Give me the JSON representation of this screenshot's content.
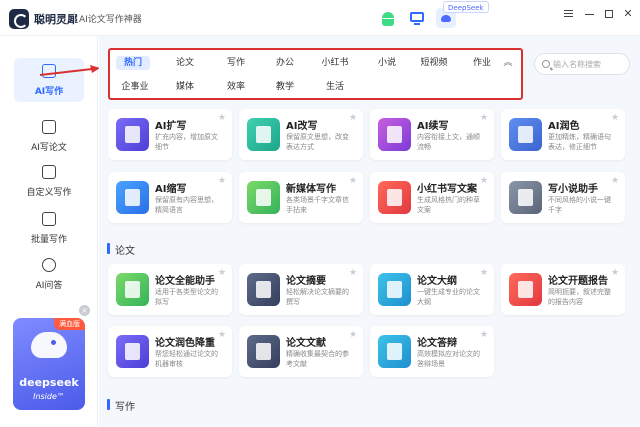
{
  "app": {
    "name": "聪明灵犀",
    "subtitle": "AI论文写作神器",
    "deepseek_badge": "DeepSeek"
  },
  "window_controls": {
    "icons": [
      "menu-icon",
      "minimize-icon",
      "maximize-icon",
      "close-icon"
    ],
    "close_glyph": "✕"
  },
  "sidebar": {
    "items": [
      {
        "label": "AI写作",
        "icon": "pen-icon",
        "active": true
      },
      {
        "label": "AI写论文",
        "icon": "paper-icon"
      },
      {
        "label": "自定义写作",
        "icon": "chart-icon"
      },
      {
        "label": "批量写作",
        "icon": "docs-icon"
      },
      {
        "label": "AI问答",
        "icon": "chat-bot-icon"
      }
    ],
    "promo": {
      "flag": "满血版",
      "brand": "deepseek",
      "sub": "Inside™",
      "close": "×"
    }
  },
  "categories": {
    "row1": [
      "热门",
      "论文",
      "写作",
      "办公",
      "小红书",
      "小说",
      "短视频",
      "作业"
    ],
    "row2": [
      "企事业",
      "媒体",
      "效率",
      "教学",
      "生活"
    ],
    "active": "热门",
    "collapse_glyph": "︽"
  },
  "search": {
    "placeholder": "输入名称搜索"
  },
  "hot_cards": [
    {
      "title": "AI扩写",
      "desc": "扩充内容，增加原文细节",
      "color": "purple"
    },
    {
      "title": "AI改写",
      "desc": "保留原文思想，改变表达方式",
      "color": "teal"
    },
    {
      "title": "AI续写",
      "desc": "内容衔接上文，通顺流畅",
      "color": "pink"
    },
    {
      "title": "AI润色",
      "desc": "更加精炼，精确语句表达，修正细节",
      "color": "book"
    },
    {
      "title": "AI缩写",
      "desc": "保留原有内容思想，精简语言",
      "color": "blue"
    },
    {
      "title": "新媒体写作",
      "desc": "各类场景千字文章信手拈来",
      "color": "green"
    },
    {
      "title": "小红书写文案",
      "desc": "生成风格热门的种草文案",
      "color": "red"
    },
    {
      "title": "写小说助手",
      "desc": "不同风格的小说一键千字",
      "color": "slate"
    }
  ],
  "sections": {
    "paper": "论文",
    "writing": "写作"
  },
  "paper_cards": [
    {
      "title": "论文全能助手",
      "desc": "适用于各类型论文的拟写",
      "color": "green"
    },
    {
      "title": "论文摘要",
      "desc": "轻松解决论文摘要的撰写",
      "color": "navy"
    },
    {
      "title": "论文大纲",
      "desc": "一键生成专业的论文大纲",
      "color": "sky"
    },
    {
      "title": "论文开题报告",
      "desc": "简明扼要，叙述完整的报告内容",
      "color": "red"
    },
    {
      "title": "论文润色降重",
      "desc": "帮您轻松通过论文的机器审核",
      "color": "purple"
    },
    {
      "title": "论文文献",
      "desc": "精确收集最契合的参考文献",
      "color": "navy"
    },
    {
      "title": "论文答辩",
      "desc": "高效模拟应对论文的答辩场景",
      "color": "sky"
    }
  ],
  "card_star_glyph": "★"
}
